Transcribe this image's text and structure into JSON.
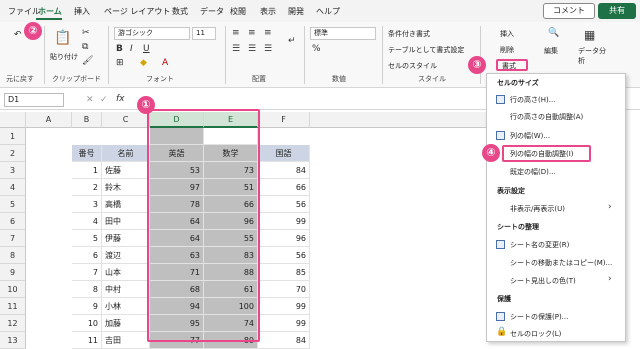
{
  "tabs": [
    "ファイル",
    "ホーム",
    "挿入",
    "ページ レイアウト",
    "数式",
    "データ",
    "校閲",
    "表示",
    "開発",
    "ヘルプ"
  ],
  "comment": "コメント",
  "share": "共有",
  "ribbon": {
    "undo": "元に戻す",
    "clipboard": "クリップボード",
    "paste": "貼り付け",
    "font_group": "フォント",
    "font": "游ゴシック",
    "size": "11",
    "align": "配置",
    "num_format": "標準",
    "num_label": "数値",
    "cond": "条件付き書式",
    "table": "テーブルとして書式設定",
    "cellstyle": "セルのスタイル",
    "style_group": "スタイル",
    "insert": "挿入",
    "delete": "削除",
    "format": "書式",
    "edit": "編集",
    "analyze": "データ分析"
  },
  "namebox": "D1",
  "fx": "fx",
  "columns": [
    "A",
    "B",
    "C",
    "D",
    "E",
    "F"
  ],
  "rows": [
    "1",
    "2",
    "3",
    "4",
    "5",
    "6",
    "7",
    "8",
    "9",
    "10",
    "11",
    "12",
    "13"
  ],
  "headers": {
    "no": "番号",
    "name": "名前",
    "eng": "英語",
    "math": "数学",
    "jp": "国語"
  },
  "data": [
    [
      "1",
      "佐藤",
      "53",
      "73",
      "84"
    ],
    [
      "2",
      "鈴木",
      "97",
      "51",
      "66"
    ],
    [
      "3",
      "高橋",
      "78",
      "66",
      "56"
    ],
    [
      "4",
      "田中",
      "64",
      "96",
      "99"
    ],
    [
      "5",
      "伊藤",
      "64",
      "55",
      "96"
    ],
    [
      "6",
      "渡辺",
      "63",
      "83",
      "56"
    ],
    [
      "7",
      "山本",
      "71",
      "88",
      "85"
    ],
    [
      "8",
      "中村",
      "68",
      "61",
      "70"
    ],
    [
      "9",
      "小林",
      "94",
      "100",
      "99"
    ],
    [
      "10",
      "加藤",
      "95",
      "74",
      "99"
    ],
    [
      "11",
      "吉田",
      "77",
      "80",
      "84"
    ]
  ],
  "badges": [
    "②",
    "①",
    "③",
    "④"
  ],
  "menu": {
    "sec1": "セルのサイズ",
    "row_h": "行の高さ(H)...",
    "row_auto": "行の高さの自動調整(A)",
    "col_w": "列の幅(W)...",
    "col_auto": "列の幅の自動調整(I)",
    "default_w": "既定の幅(D)...",
    "sec2": "表示設定",
    "hide": "非表示/再表示(U)",
    "sec3": "シートの整理",
    "rename": "シート名の変更(R)",
    "move": "シートの移動またはコピー(M)...",
    "tabcolor": "シート見出しの色(T)",
    "sec4": "保護",
    "protect": "シートの保護(P)...",
    "lock": "セルのロック(L)"
  }
}
